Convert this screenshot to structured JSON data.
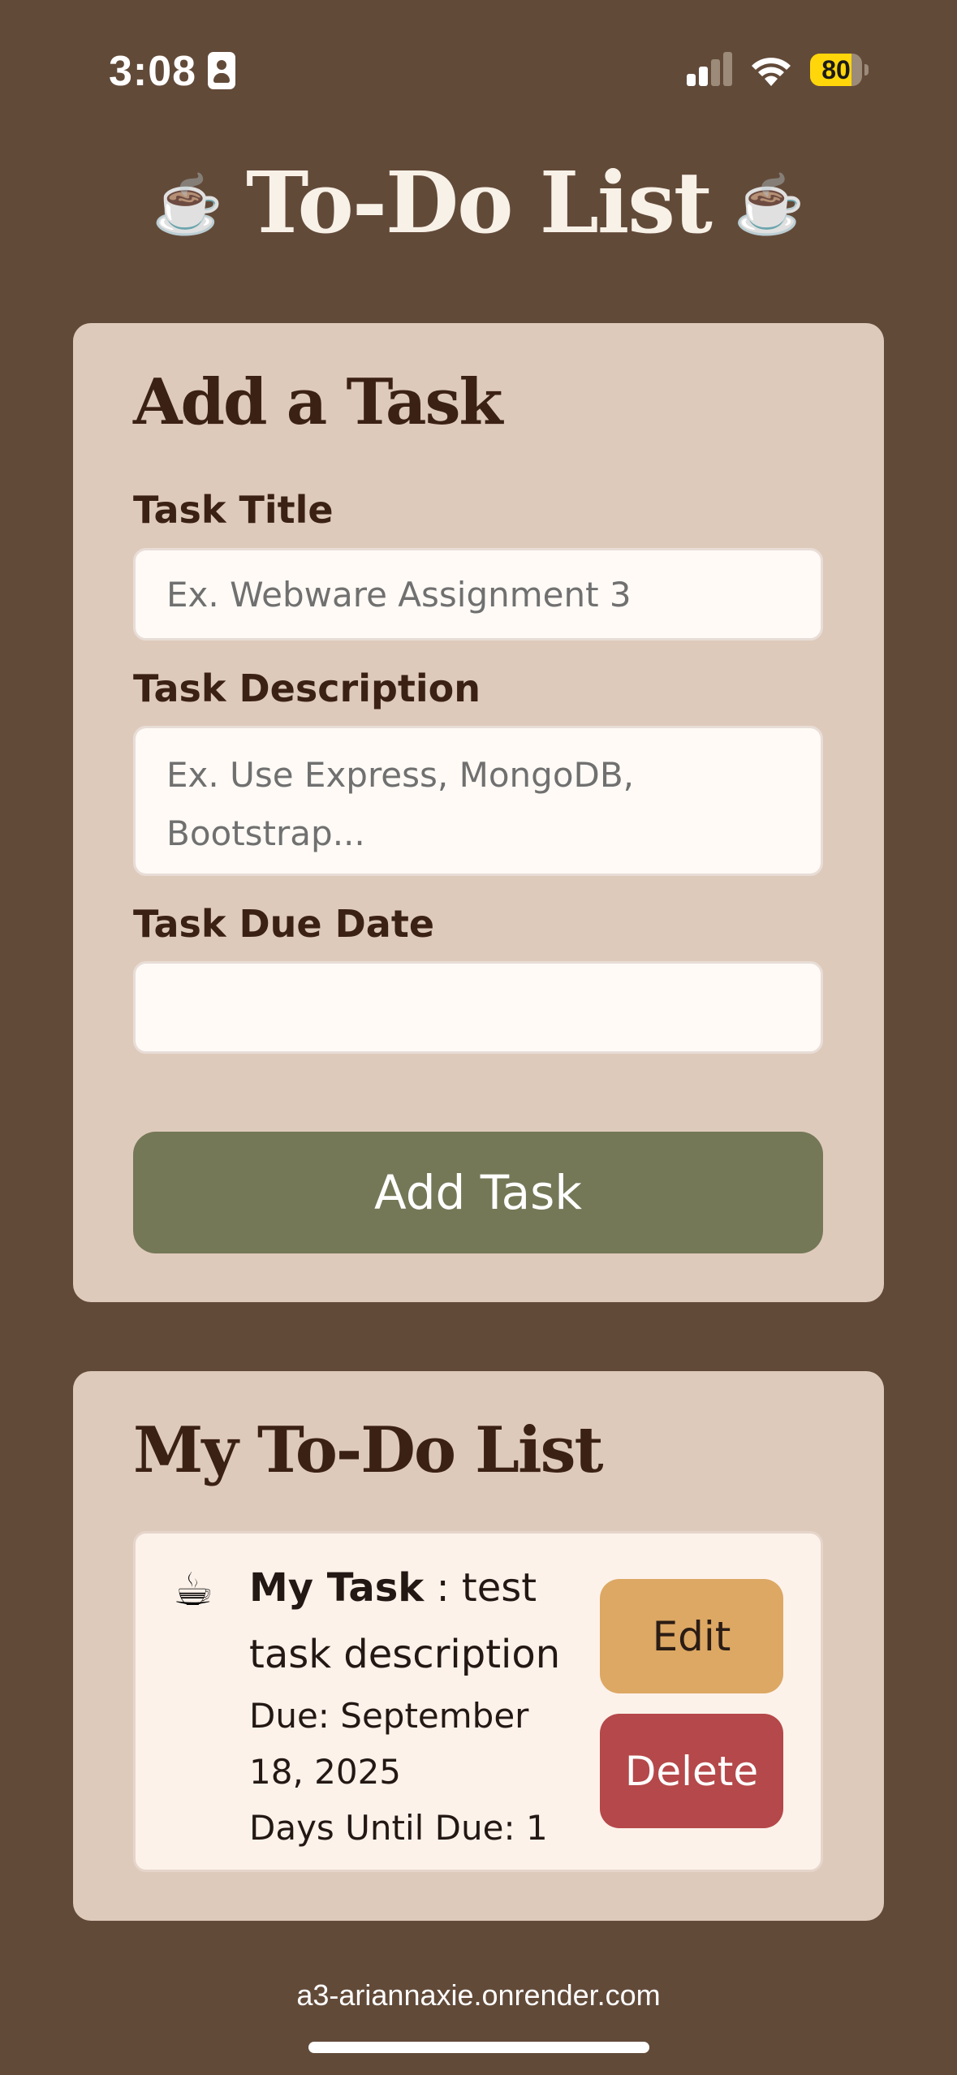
{
  "status_bar": {
    "time": "3:08",
    "battery_level": "80",
    "battery_fraction": 0.8,
    "signal_bars_active": 2,
    "signal_bars_total": 4,
    "icons": [
      "id-card-icon",
      "cellular-signal-icon",
      "wifi-icon",
      "battery-icon"
    ],
    "colors": {
      "battery_fill": "#ffd60a",
      "icon": "#ffffff",
      "icon_inactive": "#9d8b7a"
    }
  },
  "header": {
    "title": "To-Do List",
    "left_icon": "☕",
    "right_icon": "☕"
  },
  "add_task": {
    "heading": "Add a Task",
    "title_label": "Task Title",
    "title_placeholder": "Ex. Webware Assignment 3",
    "title_value": "",
    "description_label": "Task Description",
    "description_placeholder": "Ex. Use Express, MongoDB, Bootstrap...",
    "description_value": "",
    "due_date_label": "Task Due Date",
    "due_date_value": "",
    "submit_label": "Add Task"
  },
  "task_list": {
    "heading": "My To-Do List",
    "items": [
      {
        "icon": "☕",
        "title": "My Task",
        "separator": " : ",
        "description": "test task description",
        "due": "Due: September 18, 2025",
        "days_until_due": "Days Until Due: 1",
        "edit_label": "Edit",
        "delete_label": "Delete"
      }
    ]
  },
  "browser": {
    "url": "a3-ariannaxie.onrender.com"
  },
  "colors": {
    "background": "#624a39",
    "card": "#decabb",
    "heading_text": "#3b2114",
    "add_button": "#747857",
    "edit_button": "#dca864",
    "delete_button": "#b5484a",
    "input_background": "#fffaf6",
    "task_background": "#fdf2ea"
  }
}
